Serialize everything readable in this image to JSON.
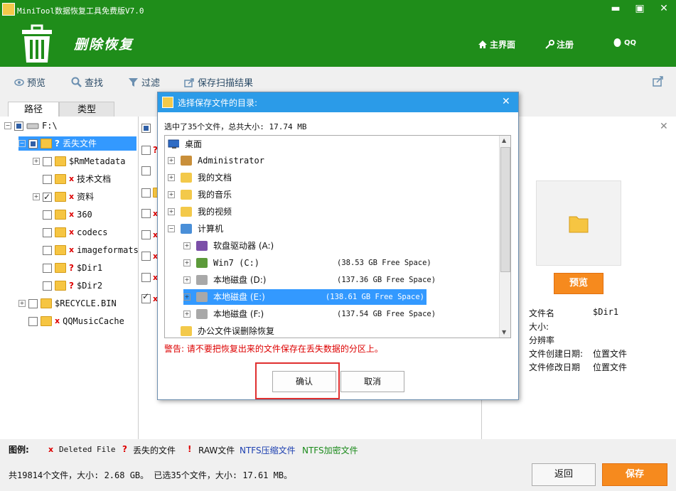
{
  "window": {
    "title": "MiniTool数据恢复工具免费版V7.0",
    "minimize": "▬",
    "maximize": "▣",
    "close": "✕"
  },
  "header": {
    "title": "删除恢复",
    "nav": {
      "home": "主界面",
      "register": "注册",
      "qq": "QQ"
    }
  },
  "toolbar": {
    "preview": "预览",
    "find": "查找",
    "filter": "过滤",
    "save_scan": "保存扫描结果"
  },
  "tabs": {
    "path": "路径",
    "type": "类型"
  },
  "tree": {
    "root": "F:\\",
    "lost": "丢失文件",
    "items": [
      "$RmMetadata",
      "技术文档",
      "资料",
      "360",
      "codecs",
      "imageformats",
      "$Dir1",
      "$Dir2"
    ],
    "recycle": "$RECYCLE.BIN",
    "qqmusic": "QQMusicCache"
  },
  "right": {
    "preview_button": "预览",
    "fields": [
      {
        "label": "文件名",
        "value": "$Dir1"
      },
      {
        "label": "大小:",
        "value": ""
      },
      {
        "label": "分辨率",
        "value": ""
      },
      {
        "label": "文件创建日期:",
        "value": "位置文件"
      },
      {
        "label": "文件修改日期",
        "value": "位置文件"
      }
    ]
  },
  "legend": {
    "label": "图例:",
    "deleted": "Deleted File",
    "lost": "丢失的文件",
    "raw": "RAW文件",
    "ntfs_compressed": "NTFS压缩文件",
    "ntfs_encrypted": "NTFS加密文件"
  },
  "status": {
    "text": "共19814个文件，大小: 2.68 GB。 已选35个文件，大小: 17.61 MB。",
    "back": "返回",
    "save": "保存"
  },
  "dialog": {
    "title": "选择保存文件的目录:",
    "summary": "选中了35个文件，总共大小: 17.74 MB",
    "desktop": "桌面",
    "entries": [
      {
        "name": "Administrator",
        "space": "",
        "indent": 1,
        "icon": "user-folder-icon"
      },
      {
        "name": "我的文档",
        "space": "",
        "indent": 1,
        "icon": "documents-folder-icon"
      },
      {
        "name": "我的音乐",
        "space": "",
        "indent": 1,
        "icon": "music-folder-icon"
      },
      {
        "name": "我的视频",
        "space": "",
        "indent": 1,
        "icon": "video-folder-icon"
      },
      {
        "name": "计算机",
        "space": "",
        "indent": 1,
        "icon": "computer-icon"
      },
      {
        "name": "软盘驱动器 (A:)",
        "space": "",
        "indent": 2,
        "icon": "floppy-icon"
      },
      {
        "name": "Win7 (C:)",
        "space": "(38.53 GB Free Space)",
        "indent": 2,
        "icon": "system-drive-icon"
      },
      {
        "name": "本地磁盘 (D:)",
        "space": "(137.36 GB Free Space)",
        "indent": 2,
        "icon": "disk-icon"
      },
      {
        "name": "本地磁盘 (E:)",
        "space": "(138.61 GB Free Space)",
        "indent": 2,
        "icon": "disk-icon",
        "selected": true
      },
      {
        "name": "本地磁盘 (F:)",
        "space": "(137.54 GB Free Space)",
        "indent": 2,
        "icon": "disk-icon"
      },
      {
        "name": "办公文件误删除恢复",
        "space": "",
        "indent": 1,
        "icon": "folder-icon"
      }
    ],
    "warning": "警告: 请不要把恢复出来的文件保存在丢失数据的分区上。",
    "ok": "确认",
    "cancel": "取消"
  },
  "colors": {
    "header_green": "#1f8d1a",
    "accent_orange": "#f68a1e",
    "dialog_blue": "#2b9be8",
    "selection_blue": "#3399ff"
  }
}
